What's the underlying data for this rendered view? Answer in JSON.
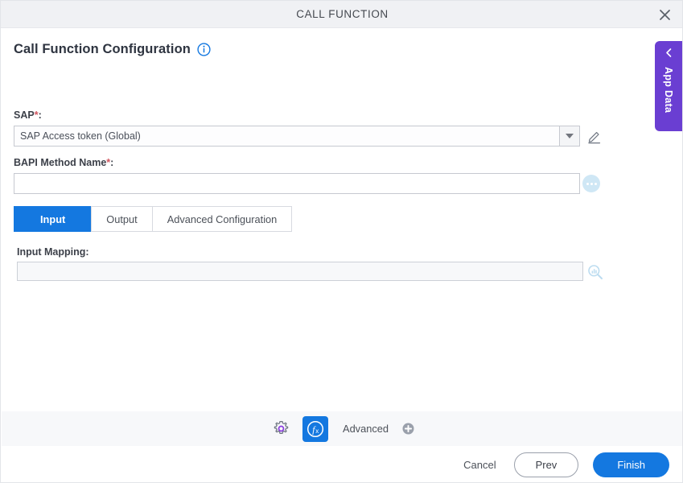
{
  "window": {
    "title": "CALL FUNCTION",
    "close_icon": "close-icon"
  },
  "page": {
    "heading": "Call Function Configuration",
    "info_icon": "info-icon"
  },
  "form": {
    "sap": {
      "label": "SAP",
      "required_marker": "*",
      "colon": ":",
      "value": "SAP Access token (Global)",
      "caret_icon": "chevron-down-icon",
      "edit_icon": "pencil-icon"
    },
    "bapi": {
      "label": "BAPI Method Name",
      "required_marker": "*",
      "colon": ":",
      "value": "",
      "placeholder": "",
      "more_icon": "ellipsis-icon"
    },
    "input_mapping": {
      "label": "Input Mapping:",
      "value": "",
      "placeholder": "",
      "search_icon": "search-data-icon"
    }
  },
  "tabs": [
    {
      "label": "Input",
      "active": true
    },
    {
      "label": "Output",
      "active": false
    },
    {
      "label": "Advanced Configuration",
      "active": false
    }
  ],
  "advanced_bar": {
    "gear_icon": "gear-icon",
    "function_icon": "fx-icon",
    "label": "Advanced",
    "add_icon": "plus-circle-icon"
  },
  "footer": {
    "cancel": "Cancel",
    "prev": "Prev",
    "finish": "Finish"
  },
  "app_data_panel": {
    "label": "App Data",
    "chevron_icon": "chevron-left-icon"
  },
  "colors": {
    "accent_blue": "#1478e0",
    "purple": "#6a3ed2",
    "required_red": "#d0555f",
    "titlebar_grey": "#f0f1f4",
    "toolbar_grey": "#f7f8fa",
    "icon_light_blue": "#cfe7f5"
  }
}
